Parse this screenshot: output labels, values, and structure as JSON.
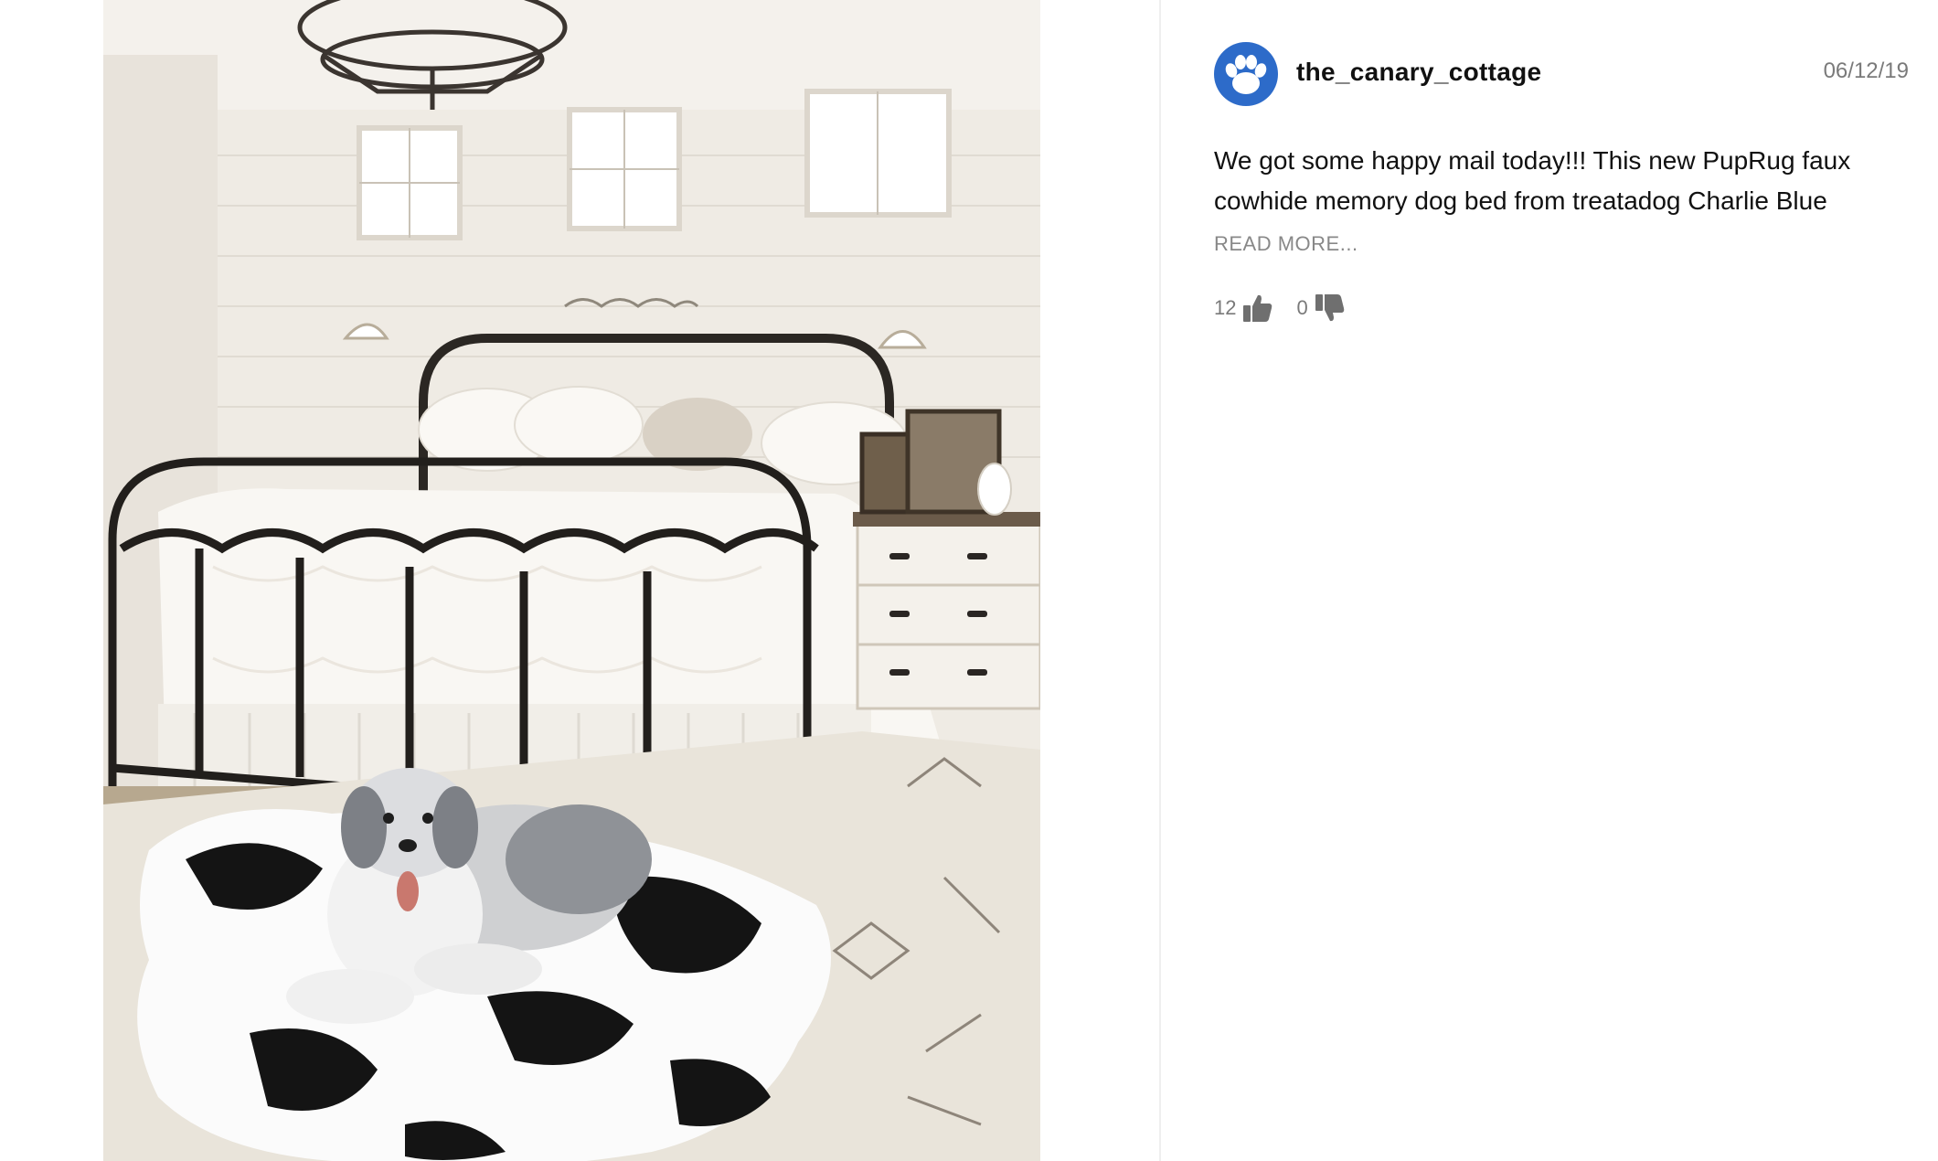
{
  "post": {
    "username": "the_canary_cottage",
    "date": "06/12/19",
    "text": "We got some happy mail today!!! This new PupRug faux cowhide memory dog bed from treatadog Charlie Blue",
    "read_more": "READ MORE...",
    "likes": "12",
    "dislikes": "0"
  },
  "icons": {
    "avatar": "paw-icon",
    "like": "thumbs-up-icon",
    "dislike": "thumbs-down-icon"
  },
  "colors": {
    "avatar_bg": "#2d6bc9",
    "vote_icon": "#6f6f6f",
    "muted_text": "#7a7a7a"
  }
}
